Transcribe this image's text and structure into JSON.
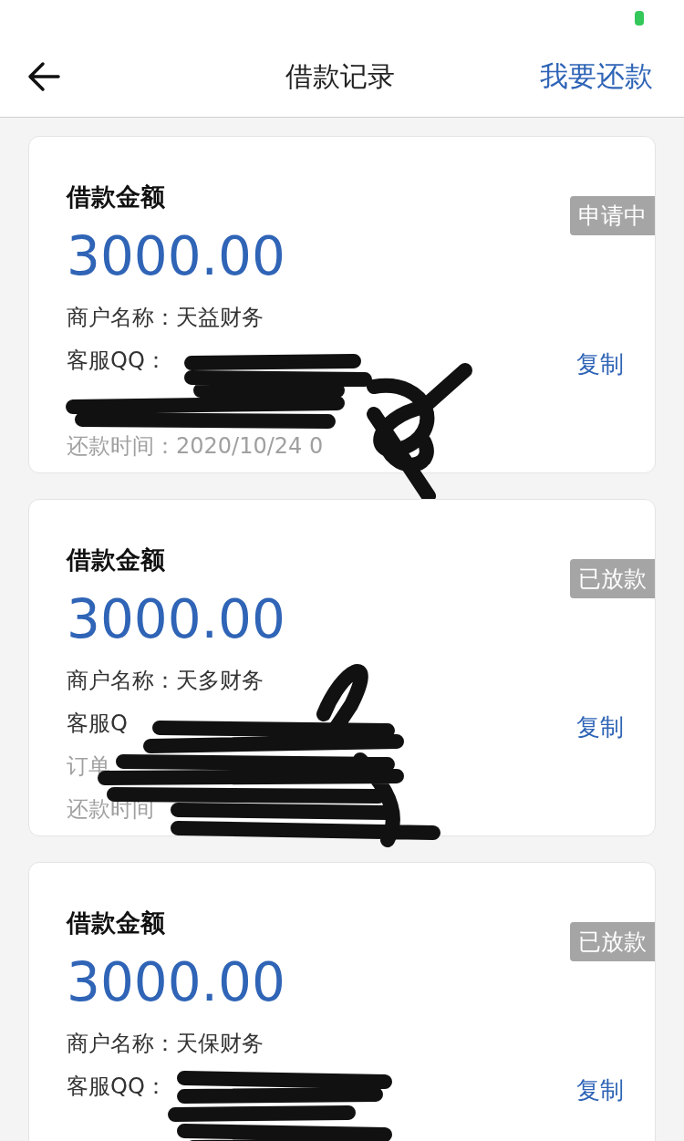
{
  "nav": {
    "title": "借款记录",
    "action": "我要还款"
  },
  "cards": [
    {
      "title": "借款金额",
      "amount": "3000.00",
      "status": "申请中",
      "merchant": "商户名称：天益财务",
      "qq": "客服QQ：",
      "repay_time": "还款时间：2020/10/24  0",
      "copy": "复制"
    },
    {
      "title": "借款金额",
      "amount": "3000.00",
      "status": "已放款",
      "merchant": "商户名称：天多财务",
      "qq": "客服Q",
      "order": "订单",
      "repay_time": "还款时间",
      "copy": "复制"
    },
    {
      "title": "借款金额",
      "amount": "3000.00",
      "status": "已放款",
      "merchant": "商户名称：天保财务",
      "qq": "客服QQ：",
      "copy": "复制"
    }
  ]
}
